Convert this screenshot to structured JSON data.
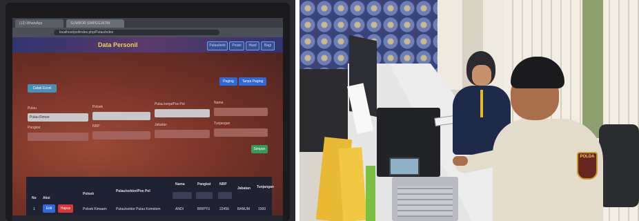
{
  "left_photo": {
    "browser": {
      "tab1": "(13) WhatsApp",
      "tab2": "SLIMBOR SIMPEGJATIM",
      "url": "localhost/pol/index.php/Pulau/index"
    },
    "app": {
      "title": "Data Personil",
      "nav": [
        "Pulau/web",
        "Posisi",
        "Hasil",
        "Bagi"
      ],
      "cetak_excel": "Cetak Excel",
      "paging": "Paging",
      "tanpa_paging": "Tanpa Paging",
      "filters": {
        "pulau_label": "Pulau",
        "pulau_value": "Pulau Rimoe",
        "polsek_label": "Polsek",
        "pulau_pol_label": "Pulau kerja/Pos Pol",
        "nama_label": "Nama",
        "pangkat_label": "Pangkat",
        "nrp_label": "NRP",
        "jabatan_label": "Jabatan",
        "tunjangan_label": "Tunjangan"
      },
      "simpan": "Simpan",
      "table": {
        "headers": [
          "No",
          "Aksi",
          "Polsek",
          "Pulau/sektor/Pos Pol",
          "Nama",
          "Pangkat",
          "NRP",
          "Jabatan",
          "Tunjangan"
        ],
        "row": {
          "no": "1",
          "edit": "Edit",
          "hapus": "Hapus",
          "polsek": "Polsek Kimaam",
          "pulau": "Pulau/sektor Pulau Komolom",
          "nama": "ANDI",
          "pangkat": "BRIPTU",
          "nrp": "22456",
          "jabatan": "BANUM",
          "tunjangan": "1500"
        }
      }
    }
  },
  "right_photo": {
    "badge_text": "POLDA"
  }
}
